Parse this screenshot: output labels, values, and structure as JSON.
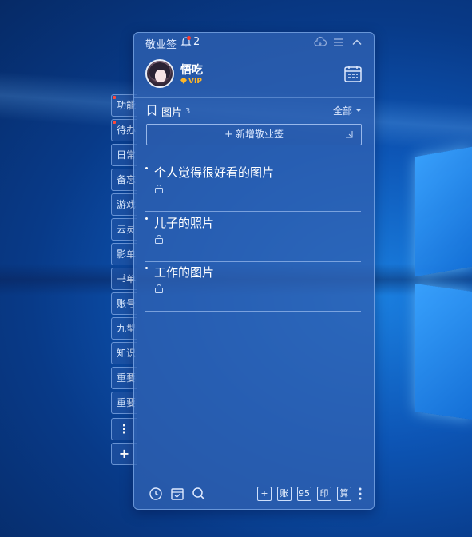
{
  "app": {
    "title": "敬业签",
    "notification_count": "2"
  },
  "side_tabs": [
    {
      "label": "功能",
      "dot": true
    },
    {
      "label": "待办",
      "dot": true
    },
    {
      "label": "日常",
      "dot": false
    },
    {
      "label": "备忘",
      "dot": false
    },
    {
      "label": "游戏",
      "dot": false
    },
    {
      "label": "云灵",
      "dot": false
    },
    {
      "label": "影单",
      "dot": false
    },
    {
      "label": "书单",
      "dot": false
    },
    {
      "label": "账号",
      "dot": false
    },
    {
      "label": "九型",
      "dot": false
    },
    {
      "label": "知识",
      "dot": false
    },
    {
      "label": "重要",
      "dot": false
    },
    {
      "label": "重要",
      "dot": false
    },
    {
      "label": "⋮",
      "dot": false
    },
    {
      "label": "+",
      "dot": false
    }
  ],
  "user": {
    "name": "悟吃",
    "badge": "VIP"
  },
  "category": {
    "label": "图片",
    "count": "3",
    "filter": "全部"
  },
  "add_button": {
    "plus": "+",
    "label": "新增敬业签"
  },
  "notes": [
    {
      "title": "个人觉得很好看的图片"
    },
    {
      "title": "儿子的照片"
    },
    {
      "title": "工作的图片"
    }
  ],
  "bottom_bar": {
    "buttons": [
      "+",
      "账",
      "95",
      "印",
      "算"
    ]
  },
  "colors": {
    "panel": "#3062B2",
    "accent_red": "#ff3b30",
    "vip_gold": "#ffb627",
    "desktop": "#0d55b5"
  },
  "icons": [
    "bell-icon",
    "cloud-sync-icon",
    "menu-icon",
    "collapse-icon",
    "calendar-icon",
    "bookmark-icon",
    "expand-icon",
    "lock-icon",
    "history-icon",
    "archive-icon",
    "search-icon",
    "more-icon"
  ]
}
